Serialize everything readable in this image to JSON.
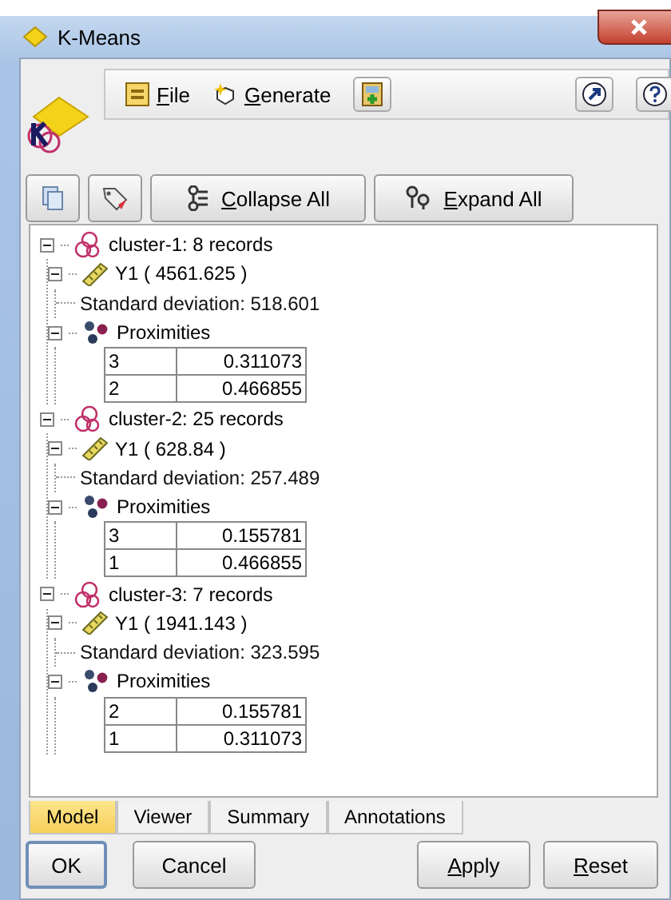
{
  "window": {
    "title": "K-Means"
  },
  "menus": [
    {
      "kind": "file",
      "mnemonic": "F",
      "rest": "ile"
    },
    {
      "kind": "generate",
      "mnemonic": "G",
      "rest": "enerate"
    }
  ],
  "view_buttons": [
    {
      "kind": "collapse",
      "mnemonic": "C",
      "rest": "ollapse All"
    },
    {
      "kind": "expand",
      "mnemonic": "E",
      "rest": "xpand All"
    }
  ],
  "tree": [
    {
      "kind": "cluster",
      "label": "cluster-1: 8 records",
      "expanded": true,
      "children": [
        {
          "kind": "field",
          "label": "Y1 ( 4561.625 )",
          "expanded": true,
          "children": [
            {
              "kind": "text",
              "label": "Standard deviation: 518.601"
            }
          ]
        },
        {
          "kind": "proximities",
          "label": "Proximities",
          "expanded": true,
          "rows": [
            [
              "3",
              "0.311073"
            ],
            [
              "2",
              "0.466855"
            ]
          ]
        }
      ]
    },
    {
      "kind": "cluster",
      "label": "cluster-2: 25 records",
      "expanded": true,
      "children": [
        {
          "kind": "field",
          "label": "Y1 ( 628.84 )",
          "expanded": true,
          "children": [
            {
              "kind": "text",
              "label": "Standard deviation: 257.489"
            }
          ]
        },
        {
          "kind": "proximities",
          "label": "Proximities",
          "expanded": true,
          "rows": [
            [
              "3",
              "0.155781"
            ],
            [
              "1",
              "0.466855"
            ]
          ]
        }
      ]
    },
    {
      "kind": "cluster",
      "label": "cluster-3: 7 records",
      "expanded": true,
      "children": [
        {
          "kind": "field",
          "label": "Y1 ( 1941.143 )",
          "expanded": true,
          "children": [
            {
              "kind": "text",
              "label": "Standard deviation: 323.595"
            }
          ]
        },
        {
          "kind": "proximities",
          "label": "Proximities",
          "expanded": true,
          "rows": [
            [
              "2",
              "0.155781"
            ],
            [
              "1",
              "0.311073"
            ]
          ]
        }
      ]
    }
  ],
  "tabs": [
    {
      "label": "Model",
      "selected": true
    },
    {
      "label": "Viewer",
      "selected": false
    },
    {
      "label": "Summary",
      "selected": false
    },
    {
      "label": "Annotations",
      "selected": false
    }
  ],
  "buttons": [
    {
      "label": "OK",
      "default": true
    },
    {
      "label": "Cancel",
      "default": false
    },
    {
      "mnemonic": "A",
      "rest": "pply",
      "default": false
    },
    {
      "mnemonic": "R",
      "rest": "eset",
      "default": false
    }
  ]
}
